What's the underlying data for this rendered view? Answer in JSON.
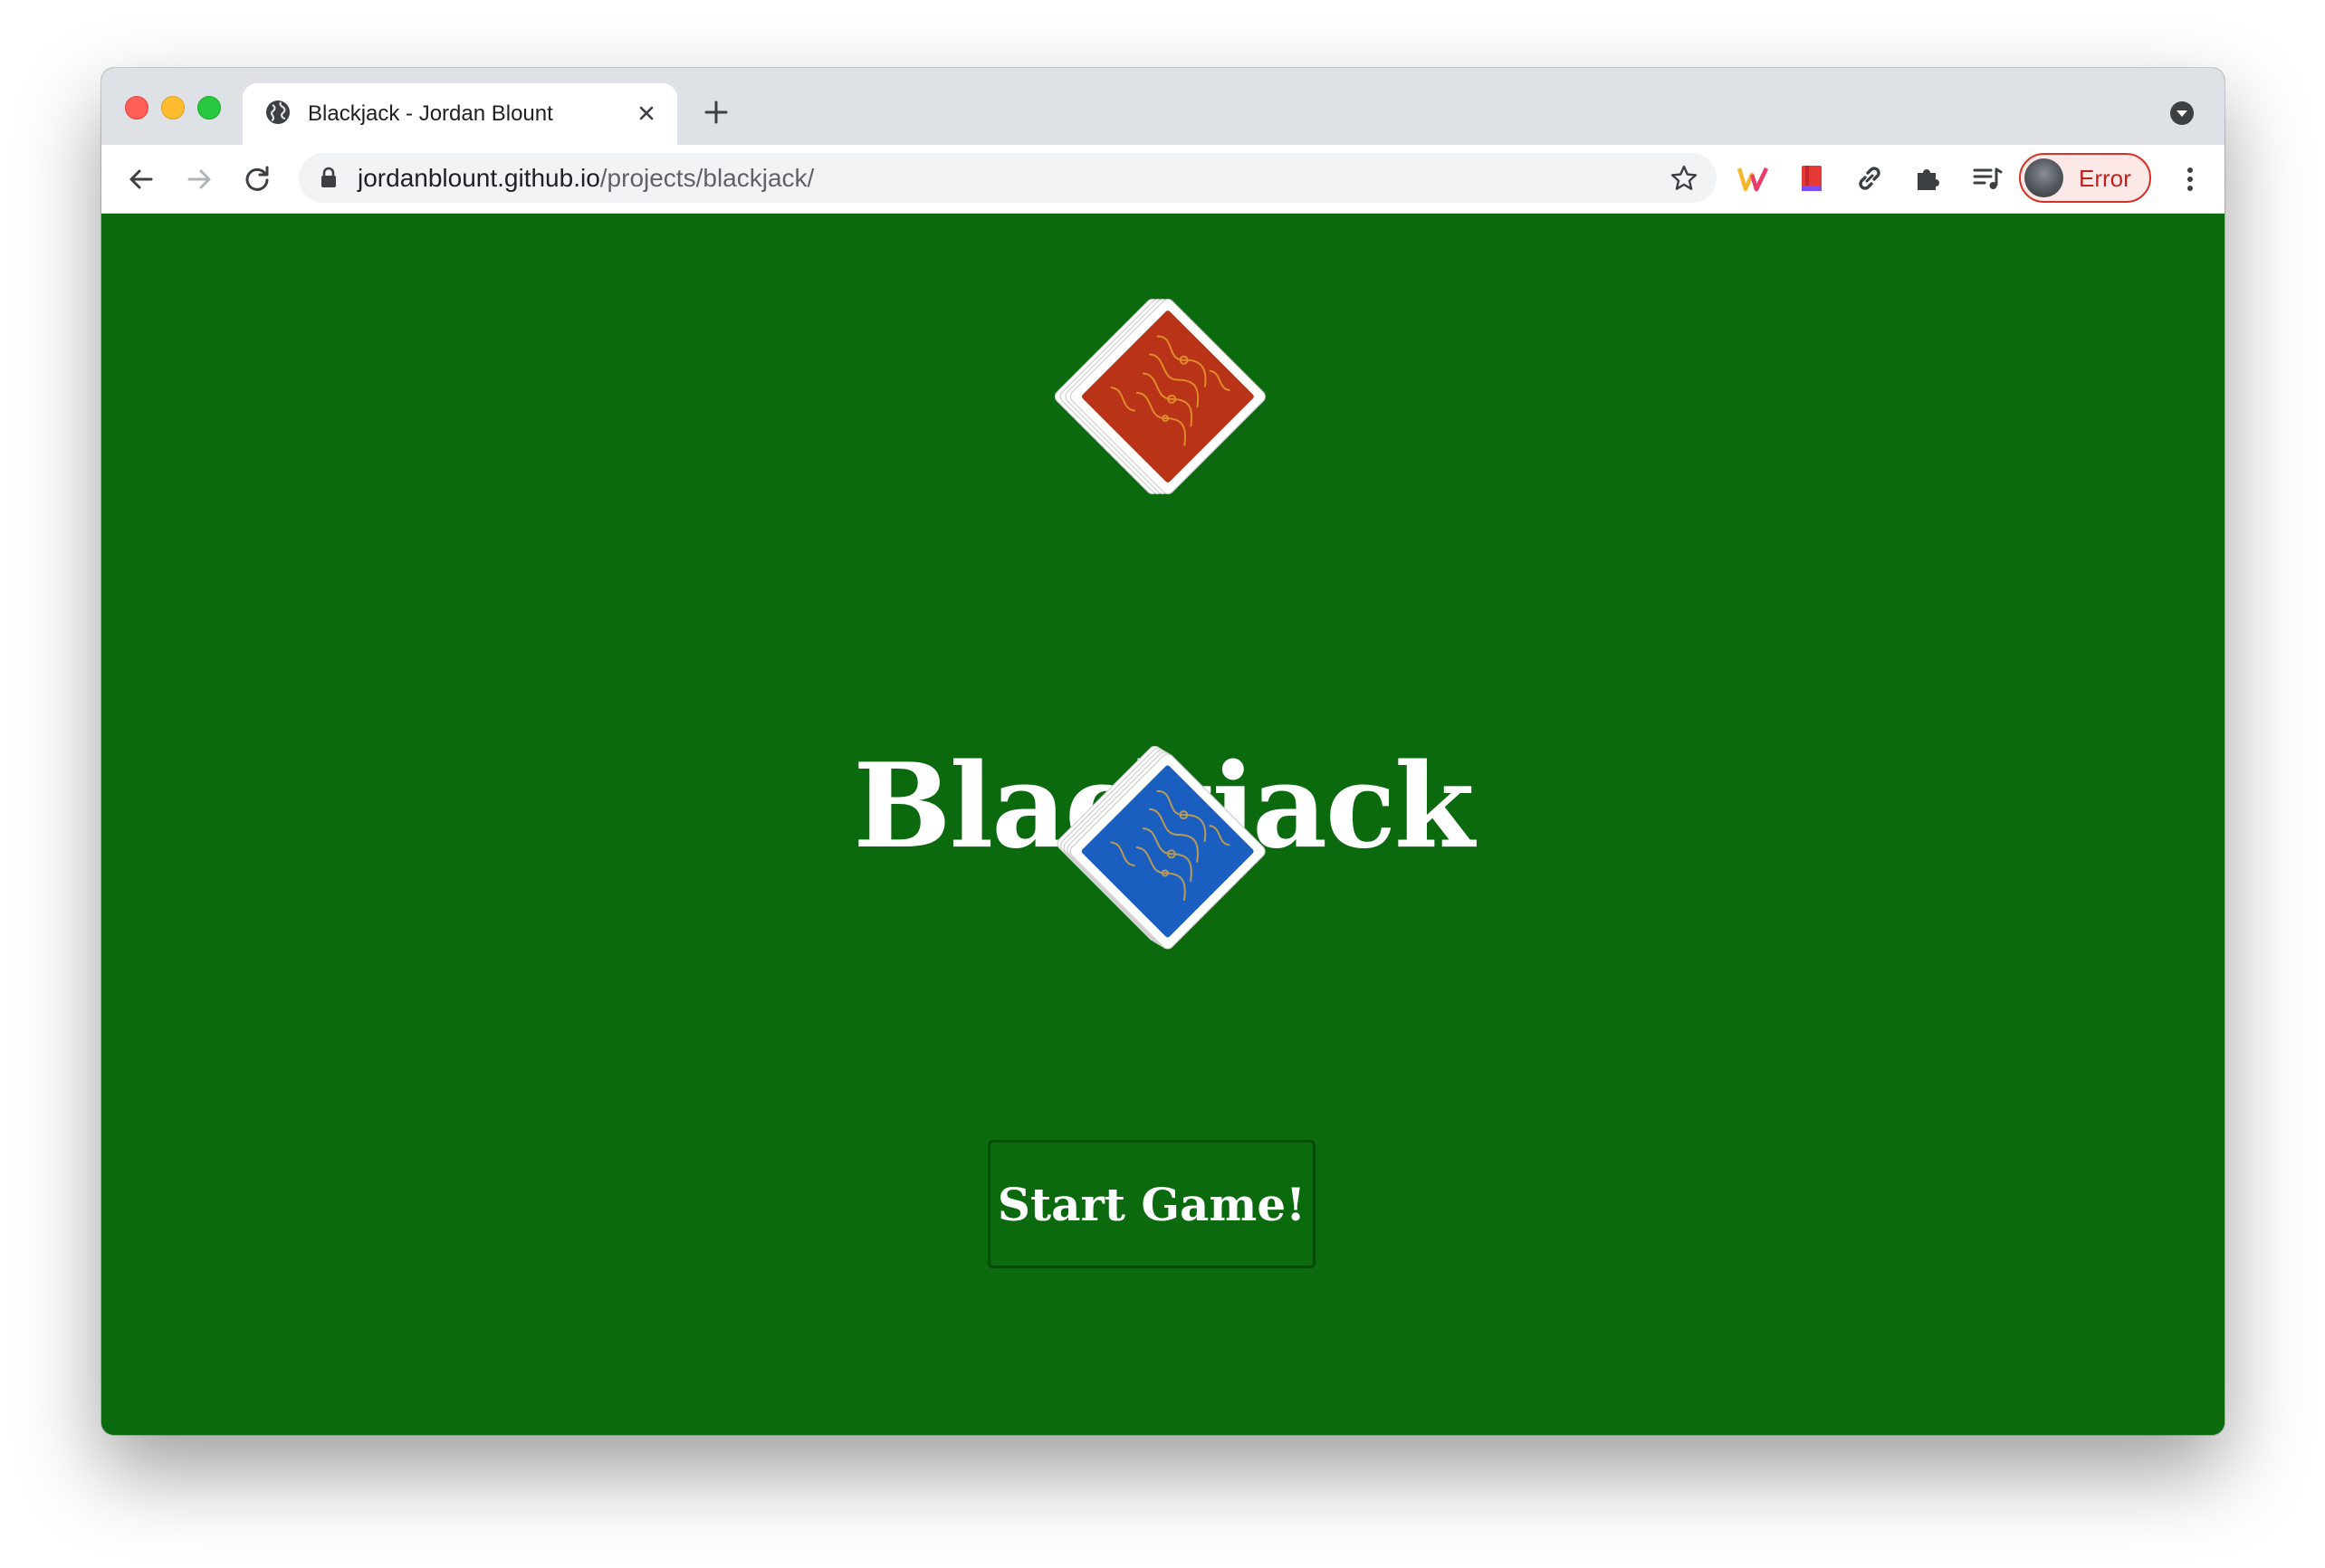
{
  "browser": {
    "tab": {
      "title": "Blackjack - Jordan Blount"
    },
    "address_bar": {
      "domain": "jordanblount.github.io",
      "path": "/projects/blackjack/"
    },
    "profile": {
      "label": "Error"
    }
  },
  "page": {
    "title": "Blackjack",
    "start_button": "Start Game!",
    "background_color": "#0a6a0d",
    "decks": [
      {
        "name": "red-card-deck",
        "color": "#b83318"
      },
      {
        "name": "blue-card-deck",
        "color": "#1a5fc0"
      }
    ]
  }
}
